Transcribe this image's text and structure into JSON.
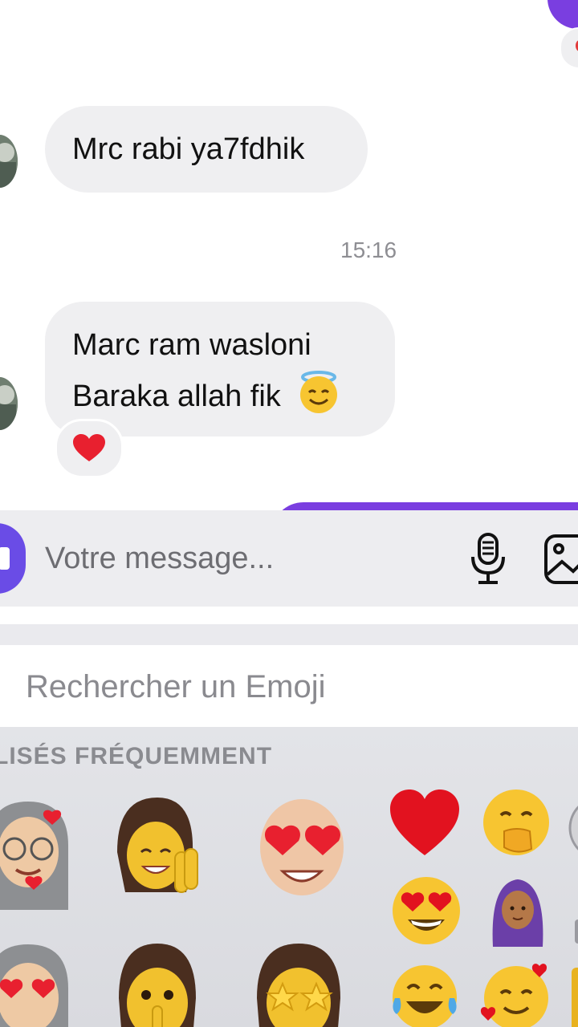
{
  "chat": {
    "messages": [
      {
        "sender": "received",
        "text": "Mrc rabi ya7fdhik"
      },
      {
        "sender": "received",
        "line1": "Marc ram wasloni",
        "line2": "Baraka allah fik",
        "emoji": "😇",
        "reaction": "❤️"
      }
    ],
    "timestamp": "15:16"
  },
  "composer": {
    "placeholder": "Votre message...",
    "icons": [
      "plus-icon",
      "microphone-icon",
      "image-icon"
    ]
  },
  "emoji_keyboard": {
    "search_placeholder": "Rechercher un Emoji",
    "section_title": "LISÉS FRÉQUEMMENT",
    "emojis": [
      "❤️",
      "🤭",
      "😍",
      "🧕",
      "😂",
      "🥰"
    ]
  },
  "colors": {
    "accent": "#7a3ee0",
    "bubble": "#efeff1",
    "composer_bg": "#ededf0",
    "keyboard_bg": "#e3e4e8",
    "timestamp": "#8e8e93"
  }
}
